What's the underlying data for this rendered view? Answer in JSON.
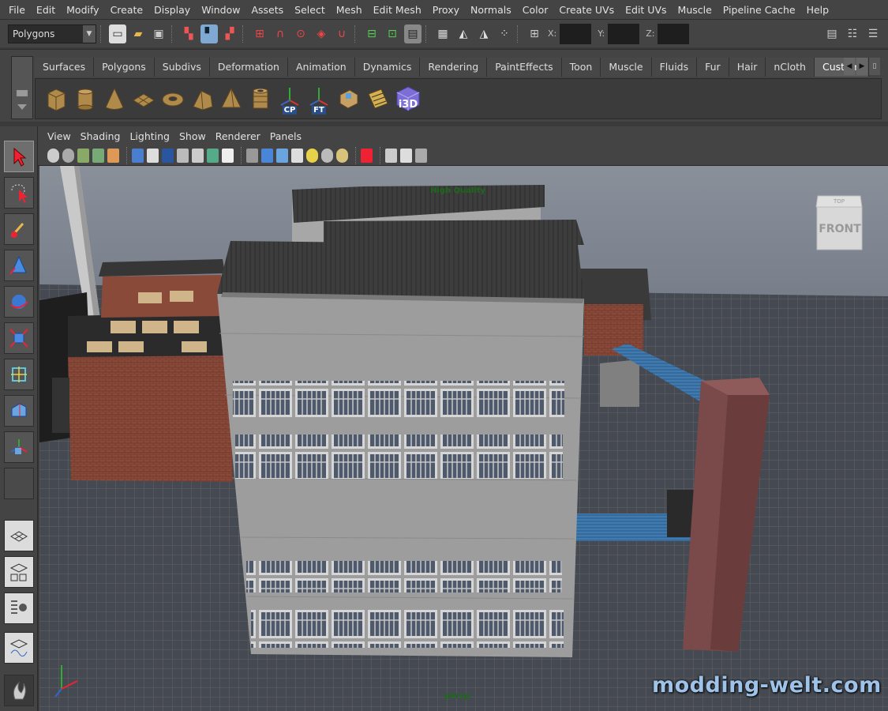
{
  "menu": [
    "File",
    "Edit",
    "Modify",
    "Create",
    "Display",
    "Window",
    "Assets",
    "Select",
    "Mesh",
    "Edit Mesh",
    "Proxy",
    "Normals",
    "Color",
    "Create UVs",
    "Edit UVs",
    "Muscle",
    "Pipeline Cache",
    "Help"
  ],
  "status": {
    "mode": "Polygons",
    "x_label": "X:",
    "y_label": "Y:",
    "z_label": "Z:"
  },
  "shelf": {
    "tabs": [
      "Surfaces",
      "Polygons",
      "Subdivs",
      "Deformation",
      "Animation",
      "Dynamics",
      "Rendering",
      "PaintEffects",
      "Toon",
      "Muscle",
      "Fluids",
      "Fur",
      "Hair",
      "nCloth",
      "Custom"
    ],
    "active_tab": "Custom",
    "tools": [
      {
        "icon": "poly-cube-icon"
      },
      {
        "icon": "poly-cylinder-icon"
      },
      {
        "icon": "poly-cone-icon"
      },
      {
        "icon": "poly-plane-icon"
      },
      {
        "icon": "poly-torus-icon"
      },
      {
        "icon": "poly-prism-icon"
      },
      {
        "icon": "poly-pyramid-icon"
      },
      {
        "icon": "poly-pipe-icon"
      },
      {
        "icon": "center-pivot-icon",
        "label": "CP"
      },
      {
        "icon": "freeze-transform-icon",
        "label": "FT"
      },
      {
        "icon": "uv-cube-icon"
      },
      {
        "icon": "uv-texture-icon"
      },
      {
        "icon": "i3d-export-icon",
        "label": "i3D"
      }
    ]
  },
  "viewport": {
    "menu": [
      "View",
      "Shading",
      "Lighting",
      "Show",
      "Renderer",
      "Panels"
    ],
    "hud_quality": "High Quality",
    "camera_name": "persp",
    "viewcube_label": "FRONT",
    "viewcube_top": "TOP"
  },
  "watermark": "modding-welt.com",
  "colors": {
    "ui_bg": "#444444",
    "viewport_bg_top": "#7f8690",
    "viewport_bg_bottom": "#3f4450",
    "grid": "#5d5d5d",
    "watermark": "#9ec2e8"
  }
}
